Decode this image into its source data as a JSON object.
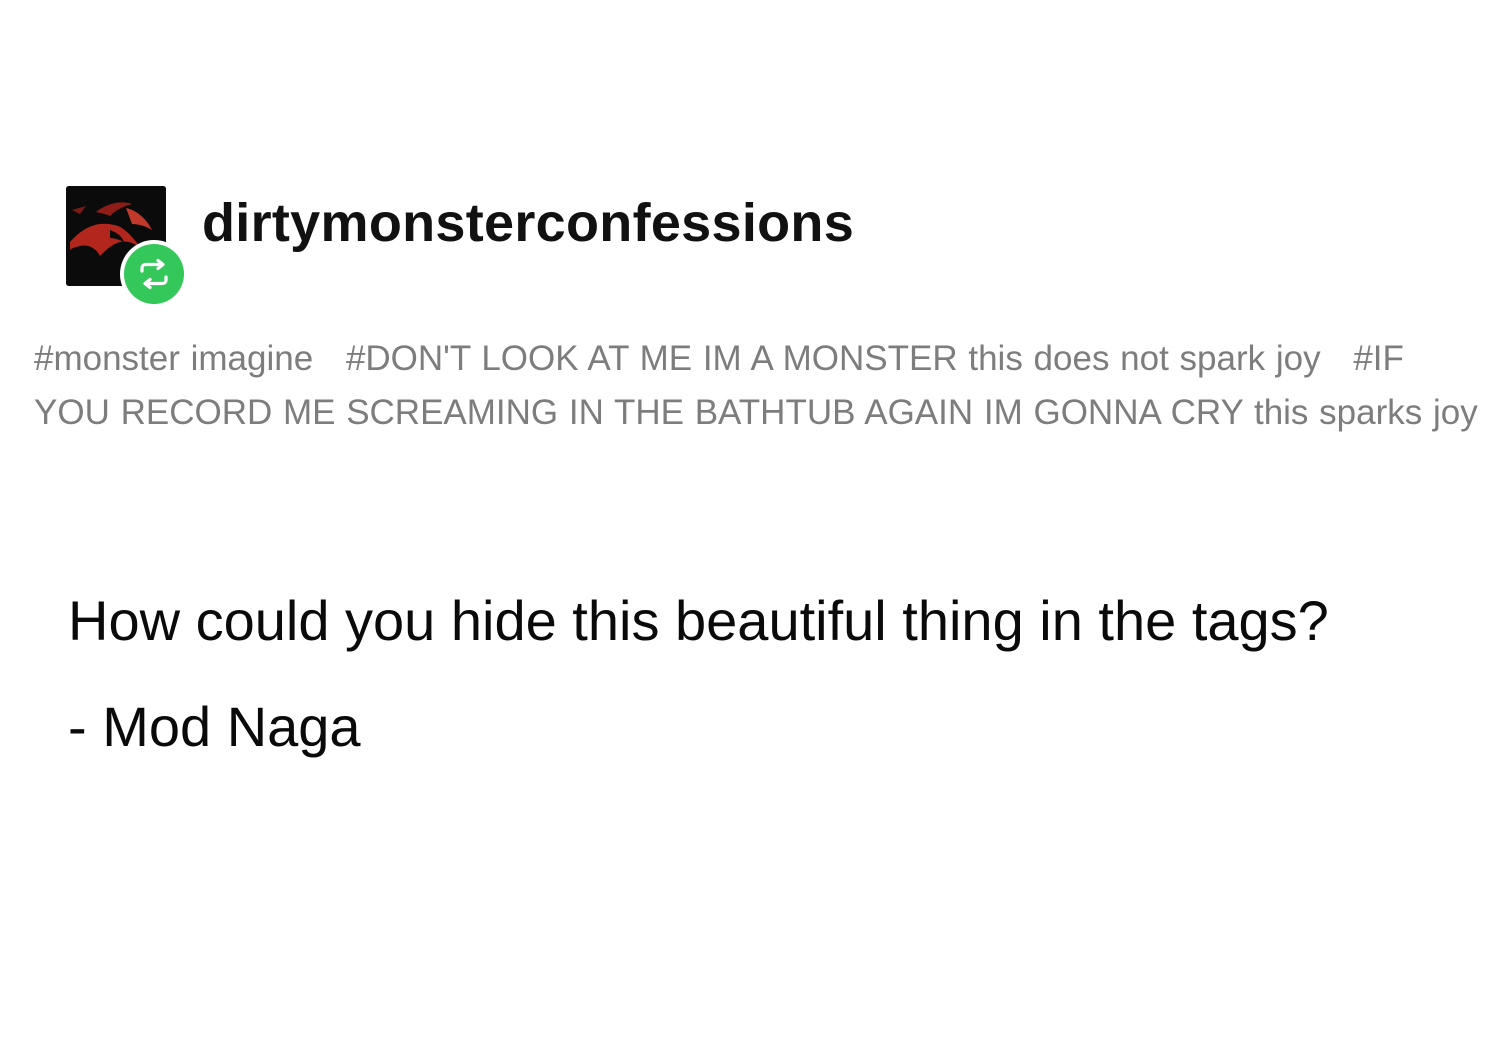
{
  "post": {
    "blog_name": "dirtymonsterconfessions",
    "avatar_icon": "dragon-avatar-icon",
    "reblog_icon": "reblog-icon",
    "reblog_color": "#34c759",
    "tags": [
      "#monster imagine",
      "#DON'T LOOK AT ME IM A MONSTER this does not spark joy",
      "#IF YOU RECORD ME SCREAMING IN THE BATHTUB AGAIN IM GONNA CRY this sparks joy"
    ],
    "body": {
      "text": "How could you hide this beautiful thing in the tags?",
      "signature": "- Mod Naga"
    }
  }
}
